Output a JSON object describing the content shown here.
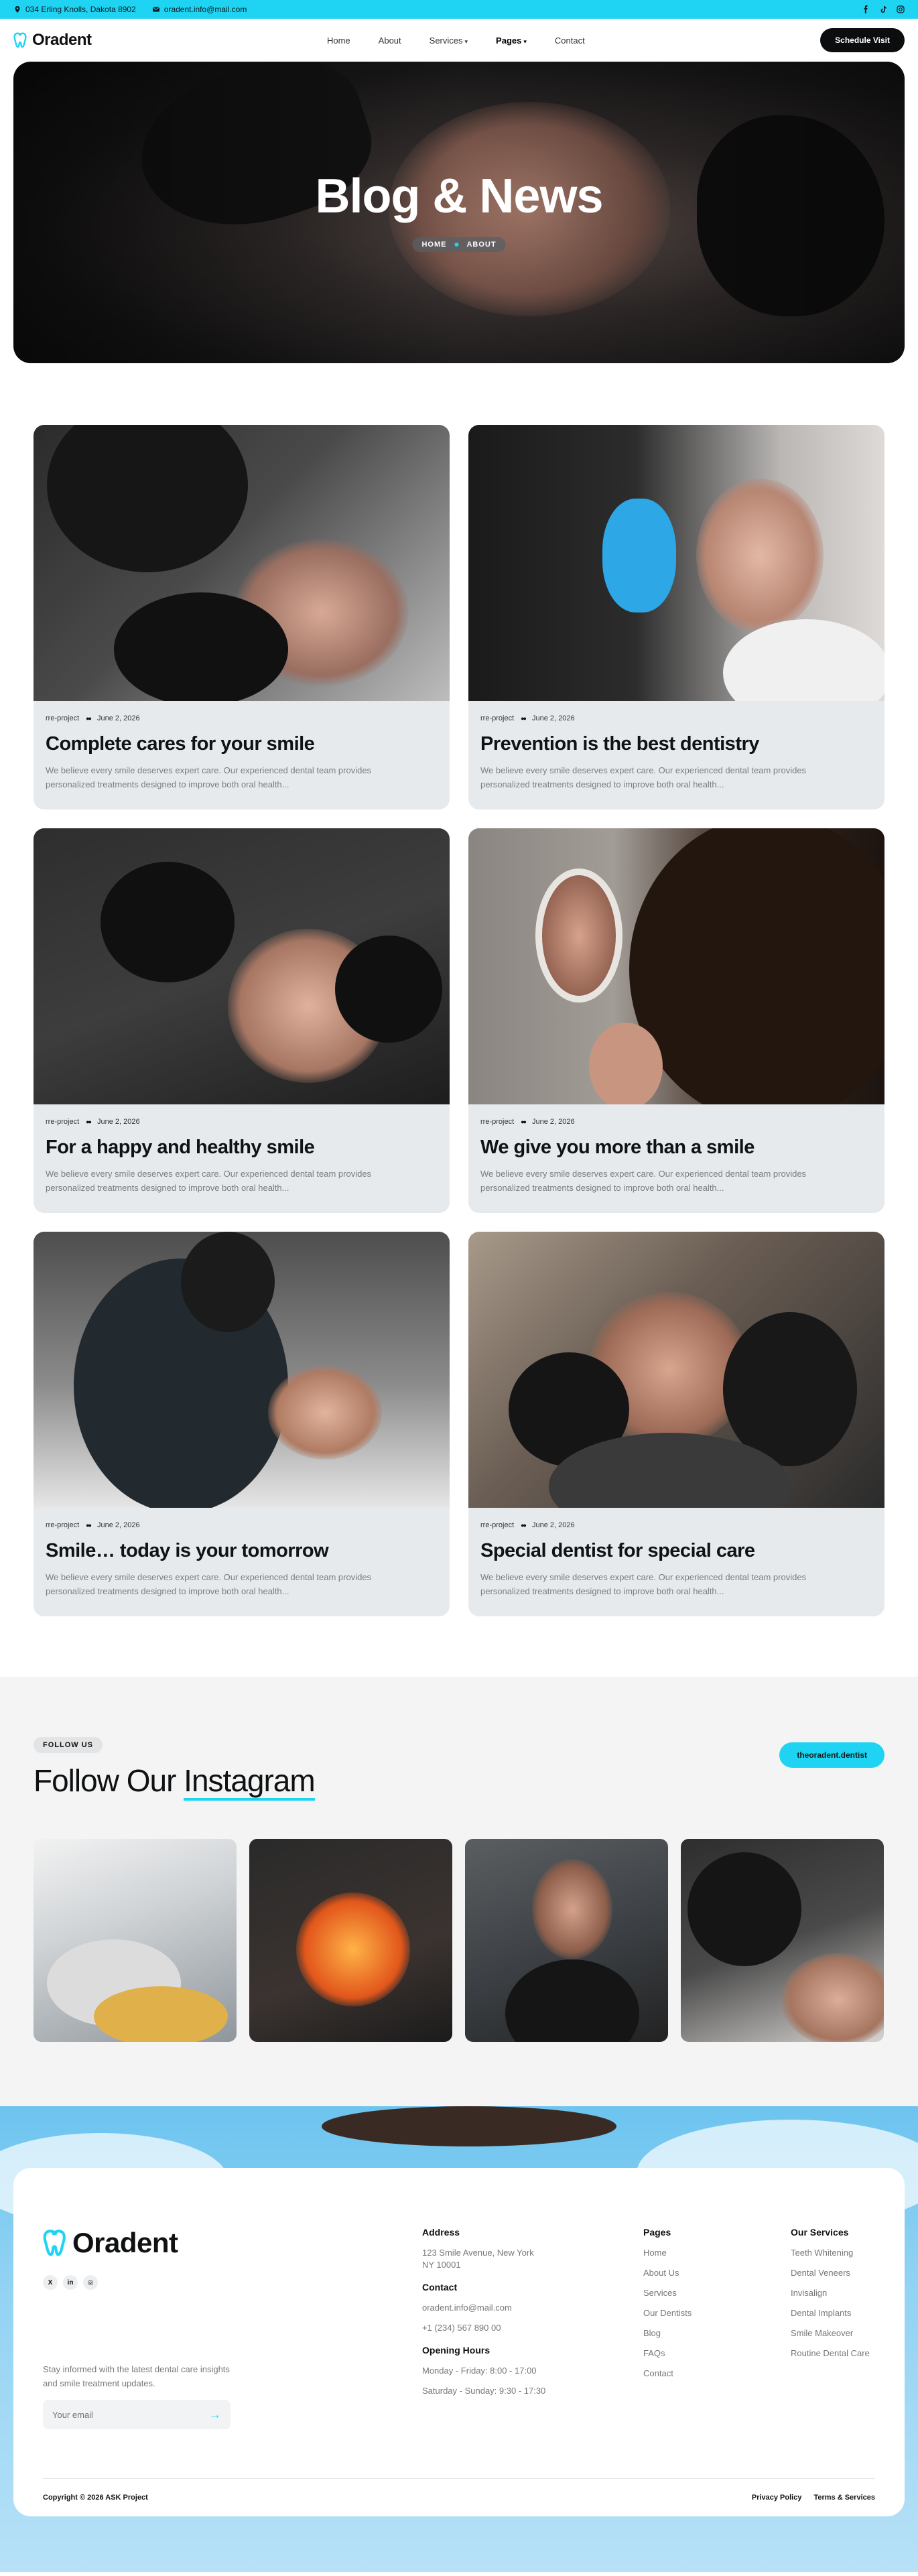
{
  "topbar": {
    "address": "034 Erling Knolls, Dakota 8902",
    "email": "oradent.info@mail.com",
    "social_icons": [
      "facebook-icon",
      "tiktok-icon",
      "instagram-icon"
    ]
  },
  "header": {
    "brand": "Oradent",
    "nav": [
      {
        "label": "Home"
      },
      {
        "label": "About"
      },
      {
        "label": "Services",
        "caret": "▾"
      },
      {
        "label": "Pages",
        "caret": "▾"
      },
      {
        "label": "Contact"
      }
    ],
    "cta": "Schedule Visit"
  },
  "hero": {
    "title": "Blog & News",
    "crumb_home": "HOME",
    "crumb_current": "ABOUT"
  },
  "posts": [
    {
      "category": "rre-project",
      "date": "June 2, 2026",
      "title": "Complete cares for your smile",
      "excerpt": "We believe every smile deserves expert care. Our experienced dental team provides personalized treatments designed to improve both oral health..."
    },
    {
      "category": "rre-project",
      "date": "June 2, 2026",
      "title": "Prevention is the best dentistry",
      "excerpt": "We believe every smile deserves expert care. Our experienced dental team provides personalized treatments designed to improve both oral health..."
    },
    {
      "category": "rre-project",
      "date": "June 2, 2026",
      "title": "For a happy and healthy smile",
      "excerpt": "We believe every smile deserves expert care. Our experienced dental team provides personalized treatments designed to improve both oral health..."
    },
    {
      "category": "rre-project",
      "date": "June 2, 2026",
      "title": "We give you more than a smile",
      "excerpt": "We believe every smile deserves expert care. Our experienced dental team provides personalized treatments designed to improve both oral health..."
    },
    {
      "category": "rre-project",
      "date": "June 2, 2026",
      "title": "Smile… today is your tomorrow",
      "excerpt": "We believe every smile deserves expert care. Our experienced dental team provides personalized treatments designed to improve both oral health..."
    },
    {
      "category": "rre-project",
      "date": "June 2, 2026",
      "title": "Special dentist for special care",
      "excerpt": "We believe every smile deserves expert care. Our experienced dental team provides personalized treatments designed to improve both oral health..."
    }
  ],
  "instagram": {
    "tag": "FOLLOW US",
    "title_plain": "Follow Our ",
    "title_underlined": "Instagram",
    "handle": "theoradent.dentist"
  },
  "footer": {
    "brand": "Oradent",
    "socials": [
      "X",
      "in",
      "◎"
    ],
    "newsletter_text": "Stay informed with the latest dental care insights and smile treatment updates.",
    "email_placeholder": "Your email",
    "address_heading": "Address",
    "address": "123 Smile Avenue, New York NY 10001",
    "contact_heading": "Contact",
    "contact_email": "oradent.info@mail.com",
    "contact_phone": "+1 (234) 567 890 00",
    "hours_heading": "Opening Hours",
    "hours_weekday": "Monday - Friday: 8:00 - 17:00",
    "hours_weekend": "Saturday - Sunday: 9:30 - 17:30",
    "pages_heading": "Pages",
    "pages": [
      "Home",
      "About Us",
      "Services",
      "Our Dentists",
      "Blog",
      "FAQs",
      "Contact"
    ],
    "services_heading": "Our Services",
    "services": [
      "Teeth Whitening",
      "Dental Veneers",
      "Invisalign",
      "Dental Implants",
      "Smile Makeover",
      "Routine Dental Care"
    ],
    "copyright": "Copyright © 2026 ASK Project",
    "privacy": "Privacy Policy",
    "terms": "Terms & Services"
  },
  "colors": {
    "accent": "#1fd4f2",
    "dark": "#0c0d0e",
    "card_bg": "#e7eaec"
  }
}
